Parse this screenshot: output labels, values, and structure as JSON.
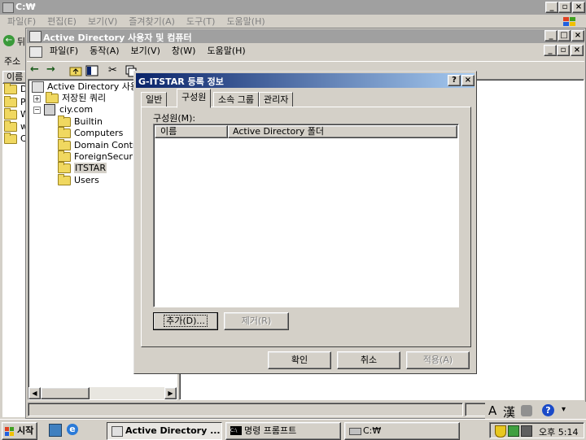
{
  "explorer": {
    "title": "C:₩",
    "menu": [
      "파일(F)",
      "편집(E)",
      "보기(V)",
      "즐겨찾기(A)",
      "도구(T)",
      "도움말(H)"
    ],
    "back_fragment": "뒤",
    "address_fragment": "주소",
    "column_fragment": "이름",
    "items_fragments": [
      "D",
      "P",
      "W",
      "w",
      "C"
    ]
  },
  "mmc": {
    "title": "Active Directory 사용자 및 컴퓨터",
    "menu": [
      "파일(F)",
      "동작(A)",
      "보기(V)",
      "창(W)",
      "도움말(H)"
    ],
    "tree": [
      {
        "label": "Active Directory 사용자",
        "level": 0
      },
      {
        "label": "저장된 쿼리",
        "level": 1
      },
      {
        "label": "ciy.com",
        "level": 1
      },
      {
        "label": "Builtin",
        "level": 2
      },
      {
        "label": "Computers",
        "level": 2
      },
      {
        "label": "Domain Contro",
        "level": 2
      },
      {
        "label": "ForeignSecurit",
        "level": 2
      },
      {
        "label": "ITSTAR",
        "level": 2,
        "selected": true
      },
      {
        "label": "Users",
        "level": 2
      }
    ]
  },
  "dialog": {
    "title": "G-ITSTAR 등록 정보",
    "help_btn": "?",
    "close_btn": "×",
    "tabs": [
      "일반",
      "구성원",
      "소속 그룹",
      "관리자"
    ],
    "active_tab": 1,
    "members_label": "구성원(M):",
    "columns": [
      "이름",
      "Active Directory 폴더"
    ],
    "add_btn": "추가(D)...",
    "remove_btn": "제거(R)",
    "ok_btn": "확인",
    "cancel_btn": "취소",
    "apply_btn": "적용(A)"
  },
  "taskbar": {
    "start": "시작",
    "tasks": [
      "Active Directory ...",
      "명령 프롬프트",
      "C:₩"
    ],
    "clock": "오후 5:14",
    "ime": [
      "A",
      "漢"
    ]
  },
  "colors": {
    "desktop": "#3a6ea5",
    "face": "#d4d0c8",
    "active_title": "#0a246a"
  }
}
